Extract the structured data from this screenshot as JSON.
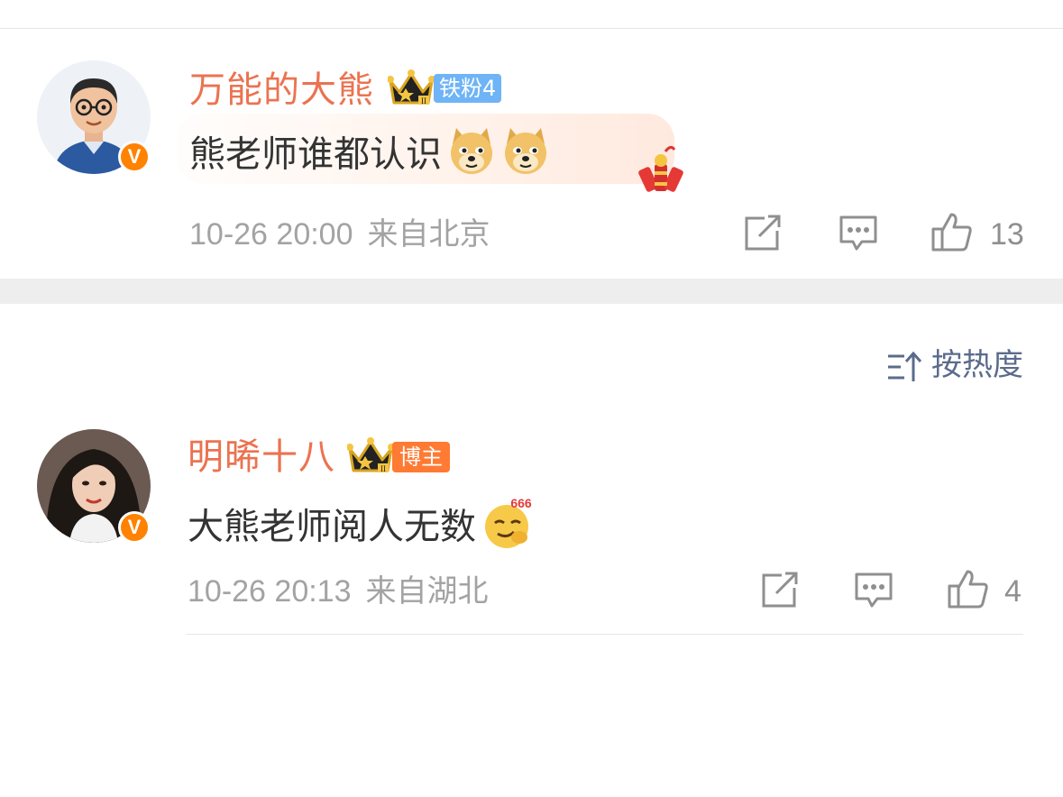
{
  "comments": [
    {
      "username": "万能的大熊",
      "badge": "铁粉4",
      "text": "熊老师谁都认识",
      "time": "10-26 20:00",
      "location": "来自北京",
      "likes": "13",
      "emojis": [
        "doge-emoji",
        "doge-emoji"
      ],
      "verified": "V"
    },
    {
      "username": "明晞十八",
      "badge": "博主",
      "text": "大熊老师阅人无数",
      "time": "10-26 20:13",
      "location": "来自湖北",
      "likes": "4",
      "emojis": [
        "666-emoji"
      ],
      "verified": "V"
    }
  ],
  "sort": {
    "label": "按热度"
  },
  "colors": {
    "username": "#eb7350",
    "fan_badge": "#6eb4f6",
    "blogger_badge": "#ff7a33",
    "meta": "#a3a3a3",
    "sort": "#5b6b8c"
  }
}
